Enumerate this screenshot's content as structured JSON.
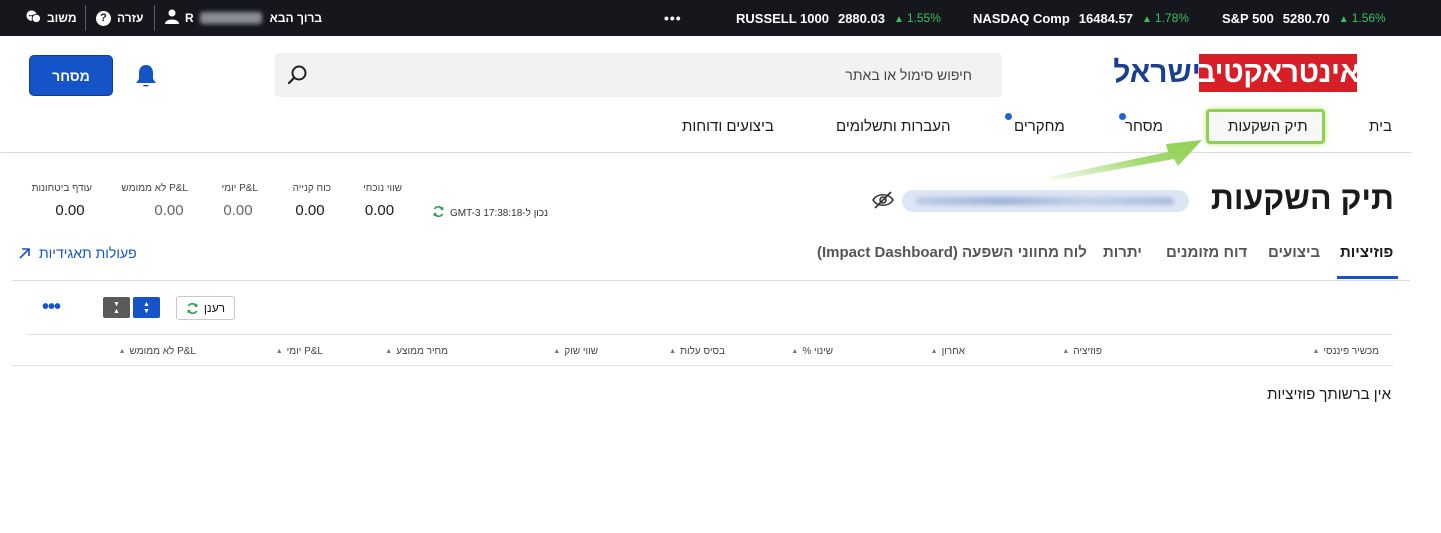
{
  "topbar": {
    "feedback_label": "משוב",
    "help_label": "עזרה",
    "greeting": "ברוך הבא",
    "greeting_initial": "R",
    "more_label": "•••",
    "tickers": [
      {
        "name": "RUSSELL 1000",
        "value": "2880.03",
        "change": "1.55%",
        "color": "#3fbf62"
      },
      {
        "name": "NASDAQ Comp",
        "value": "16484.57",
        "change": "1.78%",
        "color": "#3fbf62"
      },
      {
        "name": "S&P 500",
        "value": "5280.70",
        "change": "1.56%",
        "color": "#3fbf62"
      }
    ]
  },
  "header": {
    "logo_red": "אינטראקטיב",
    "logo_blue": "ישראל",
    "search_placeholder": "חיפוש סימול או באתר",
    "trade_button": "מסחר"
  },
  "nav": {
    "items": [
      {
        "label": "בית"
      },
      {
        "label": "תיק השקעות"
      },
      {
        "label": "מסחר"
      },
      {
        "label": "מחקרים"
      },
      {
        "label": "העברות ותשלומים"
      },
      {
        "label": "ביצועים ודוחות"
      }
    ]
  },
  "portfolio": {
    "title": "תיק השקעות",
    "as_of": "נכון ל-17:38:18 GMT-3",
    "stats": [
      {
        "label": "שווי נוכחי",
        "value": "0.00"
      },
      {
        "label": "כוח קנייה",
        "value": "0.00"
      },
      {
        "label": "P&L יומי",
        "value": "0.00"
      },
      {
        "label": "P&L לא ממומש",
        "value": "0.00"
      },
      {
        "label": "עודף ביטחונות",
        "value": "0.00"
      }
    ]
  },
  "tabs": {
    "items": [
      {
        "label": "פוזיציות"
      },
      {
        "label": "ביצועים"
      },
      {
        "label": "דוח מזומנים"
      },
      {
        "label": "יתרות"
      },
      {
        "label": "לוח מחווני השפעה (Impact Dashboard)"
      }
    ],
    "corporate_actions": "פעולות תאגידיות"
  },
  "toolbar": {
    "refresh_label": "רענן",
    "more_label": "•••"
  },
  "table": {
    "columns": [
      "מכשיר פיננסי",
      "פוזיציה",
      "אחרון",
      "שינוי %",
      "בסיס עלות",
      "שווי שוק",
      "מחיר ממוצע",
      "P&L יומי",
      "P&L לא ממומש"
    ],
    "empty_message": "אין ברשותך פוזיציות"
  },
  "colors": {
    "accent": "#1453c8",
    "positive": "#3fbf62",
    "logo_red": "#d81e26",
    "logo_blue": "#1a3f8f",
    "highlight": "#8ed04f"
  }
}
